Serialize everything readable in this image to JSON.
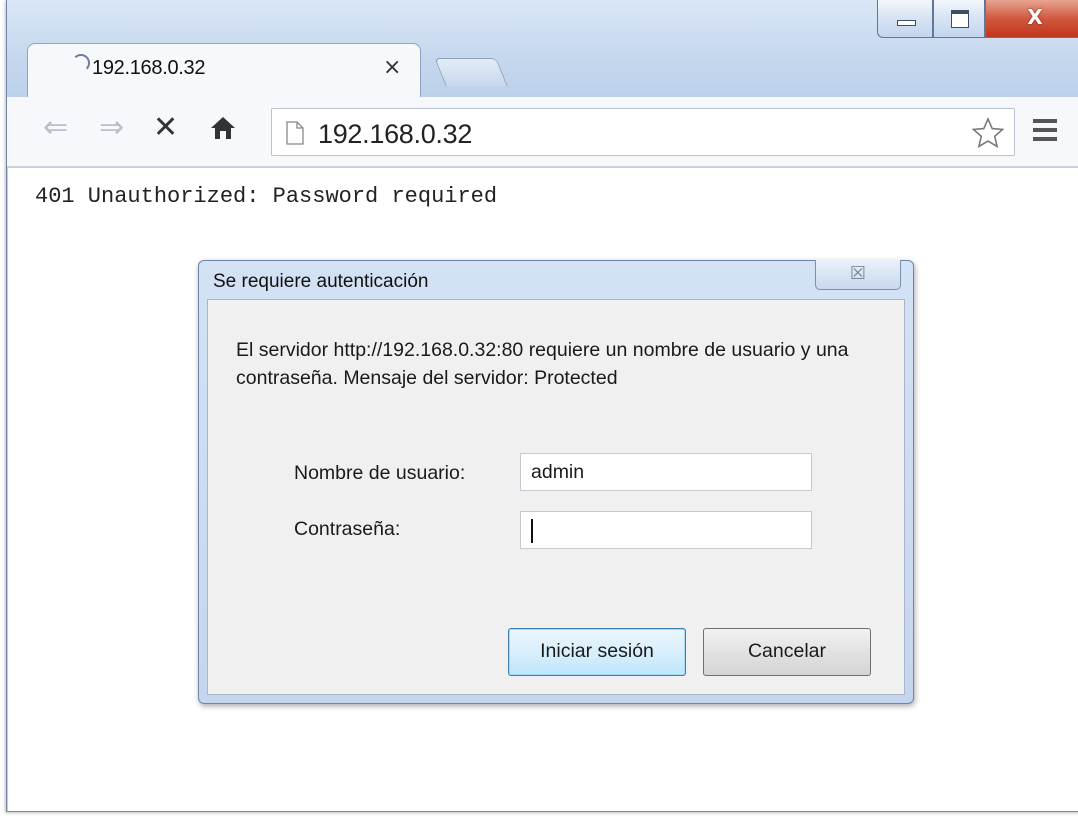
{
  "browser": {
    "tab": {
      "title": "192.168.0.32",
      "close_glyph": "×",
      "state": "loading"
    },
    "window_controls": {
      "close_glyph": "X"
    },
    "toolbar": {
      "back_glyph": "⇐",
      "forward_glyph": "⇒",
      "stop_glyph": "✕",
      "address": "192.168.0.32"
    }
  },
  "page": {
    "error_text": "401 Unauthorized: Password required"
  },
  "dialog": {
    "title": "Se requiere autenticación",
    "close_glyph": "☒",
    "message": "El servidor http://192.168.0.32:80 requiere un nombre de usuario y una contraseña. Mensaje del servidor: Protected",
    "username_label": "Nombre de usuario:",
    "username_value": "admin",
    "password_label": "Contraseña:",
    "password_value": "",
    "login_button": "Iniciar sesión",
    "cancel_button": "Cancelar"
  },
  "colors": {
    "window_frame": "#c5d7ee",
    "close_button": "#c1361d",
    "default_button_border": "#3c7fb1"
  }
}
